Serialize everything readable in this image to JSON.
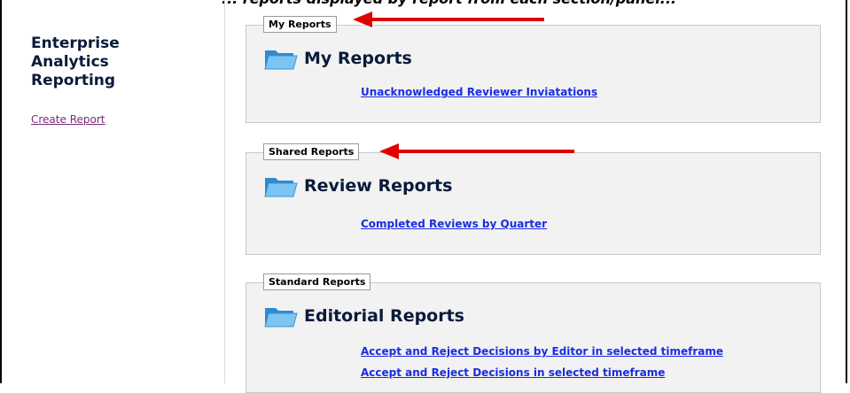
{
  "caption": "... reports displayed by report from each section/panel...",
  "sidebar": {
    "app_title": "Enterprise Analytics Reporting",
    "create_link": "Create Report"
  },
  "panels": [
    {
      "legend": "My Reports",
      "title": "My Reports",
      "links": [
        "Unacknowledged Reviewer Inviatations"
      ]
    },
    {
      "legend": "Shared Reports",
      "title": "Review Reports",
      "links": [
        "Completed Reviews by Quarter"
      ]
    },
    {
      "legend": "Standard Reports",
      "title": "Editorial Reports",
      "links": [
        "Accept and Reject Decisions by Editor in selected timeframe",
        "Accept and Reject Decisions in selected timeframe"
      ]
    }
  ],
  "colors": {
    "arrow": "#e00000",
    "link": "#1a2de0",
    "panel_bg": "#f2f2f2"
  },
  "icons": {
    "folder": "folder-icon",
    "annotation": "red-arrow"
  }
}
